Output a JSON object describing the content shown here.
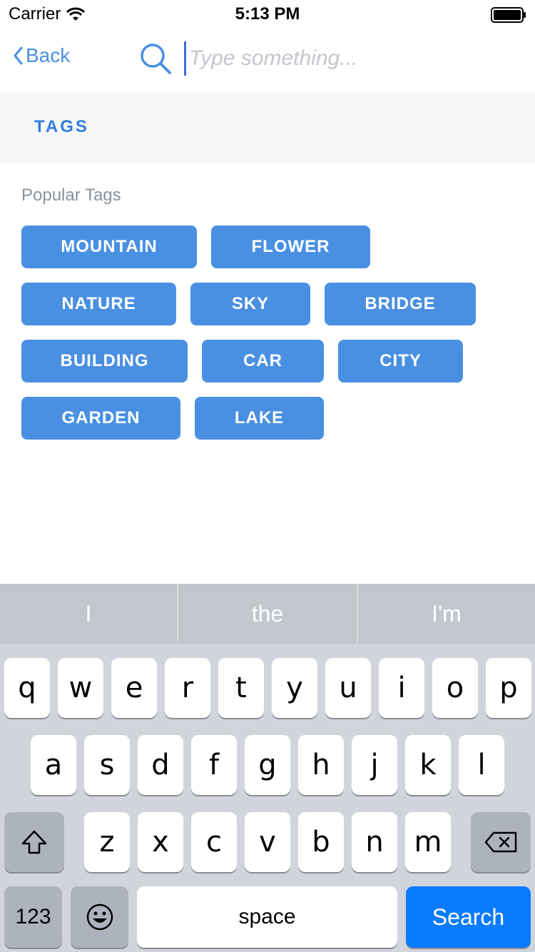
{
  "status_bar": {
    "carrier": "Carrier",
    "time": "5:13 PM"
  },
  "nav": {
    "back_label": "Back",
    "search_placeholder": "Type something...",
    "search_value": ""
  },
  "section": {
    "title": "TAGS"
  },
  "popular": {
    "label": "Popular Tags",
    "tags": [
      "MOUNTAIN",
      "FLOWER",
      "NATURE",
      "SKY",
      "BRIDGE",
      "BUILDING",
      "CAR",
      "CITY",
      "GARDEN",
      "LAKE"
    ]
  },
  "keyboard": {
    "suggestions": [
      "I",
      "the",
      "I'm"
    ],
    "row1": [
      "q",
      "w",
      "e",
      "r",
      "t",
      "y",
      "u",
      "i",
      "o",
      "p"
    ],
    "row2": [
      "a",
      "s",
      "d",
      "f",
      "g",
      "h",
      "j",
      "k",
      "l"
    ],
    "row3": [
      "z",
      "x",
      "c",
      "v",
      "b",
      "n",
      "m"
    ],
    "numbers_label": "123",
    "space_label": "space",
    "search_label": "Search"
  },
  "colors": {
    "accent": "#4a90e2",
    "tags_title": "#2f7de1",
    "search_key": "#0a7bff"
  }
}
